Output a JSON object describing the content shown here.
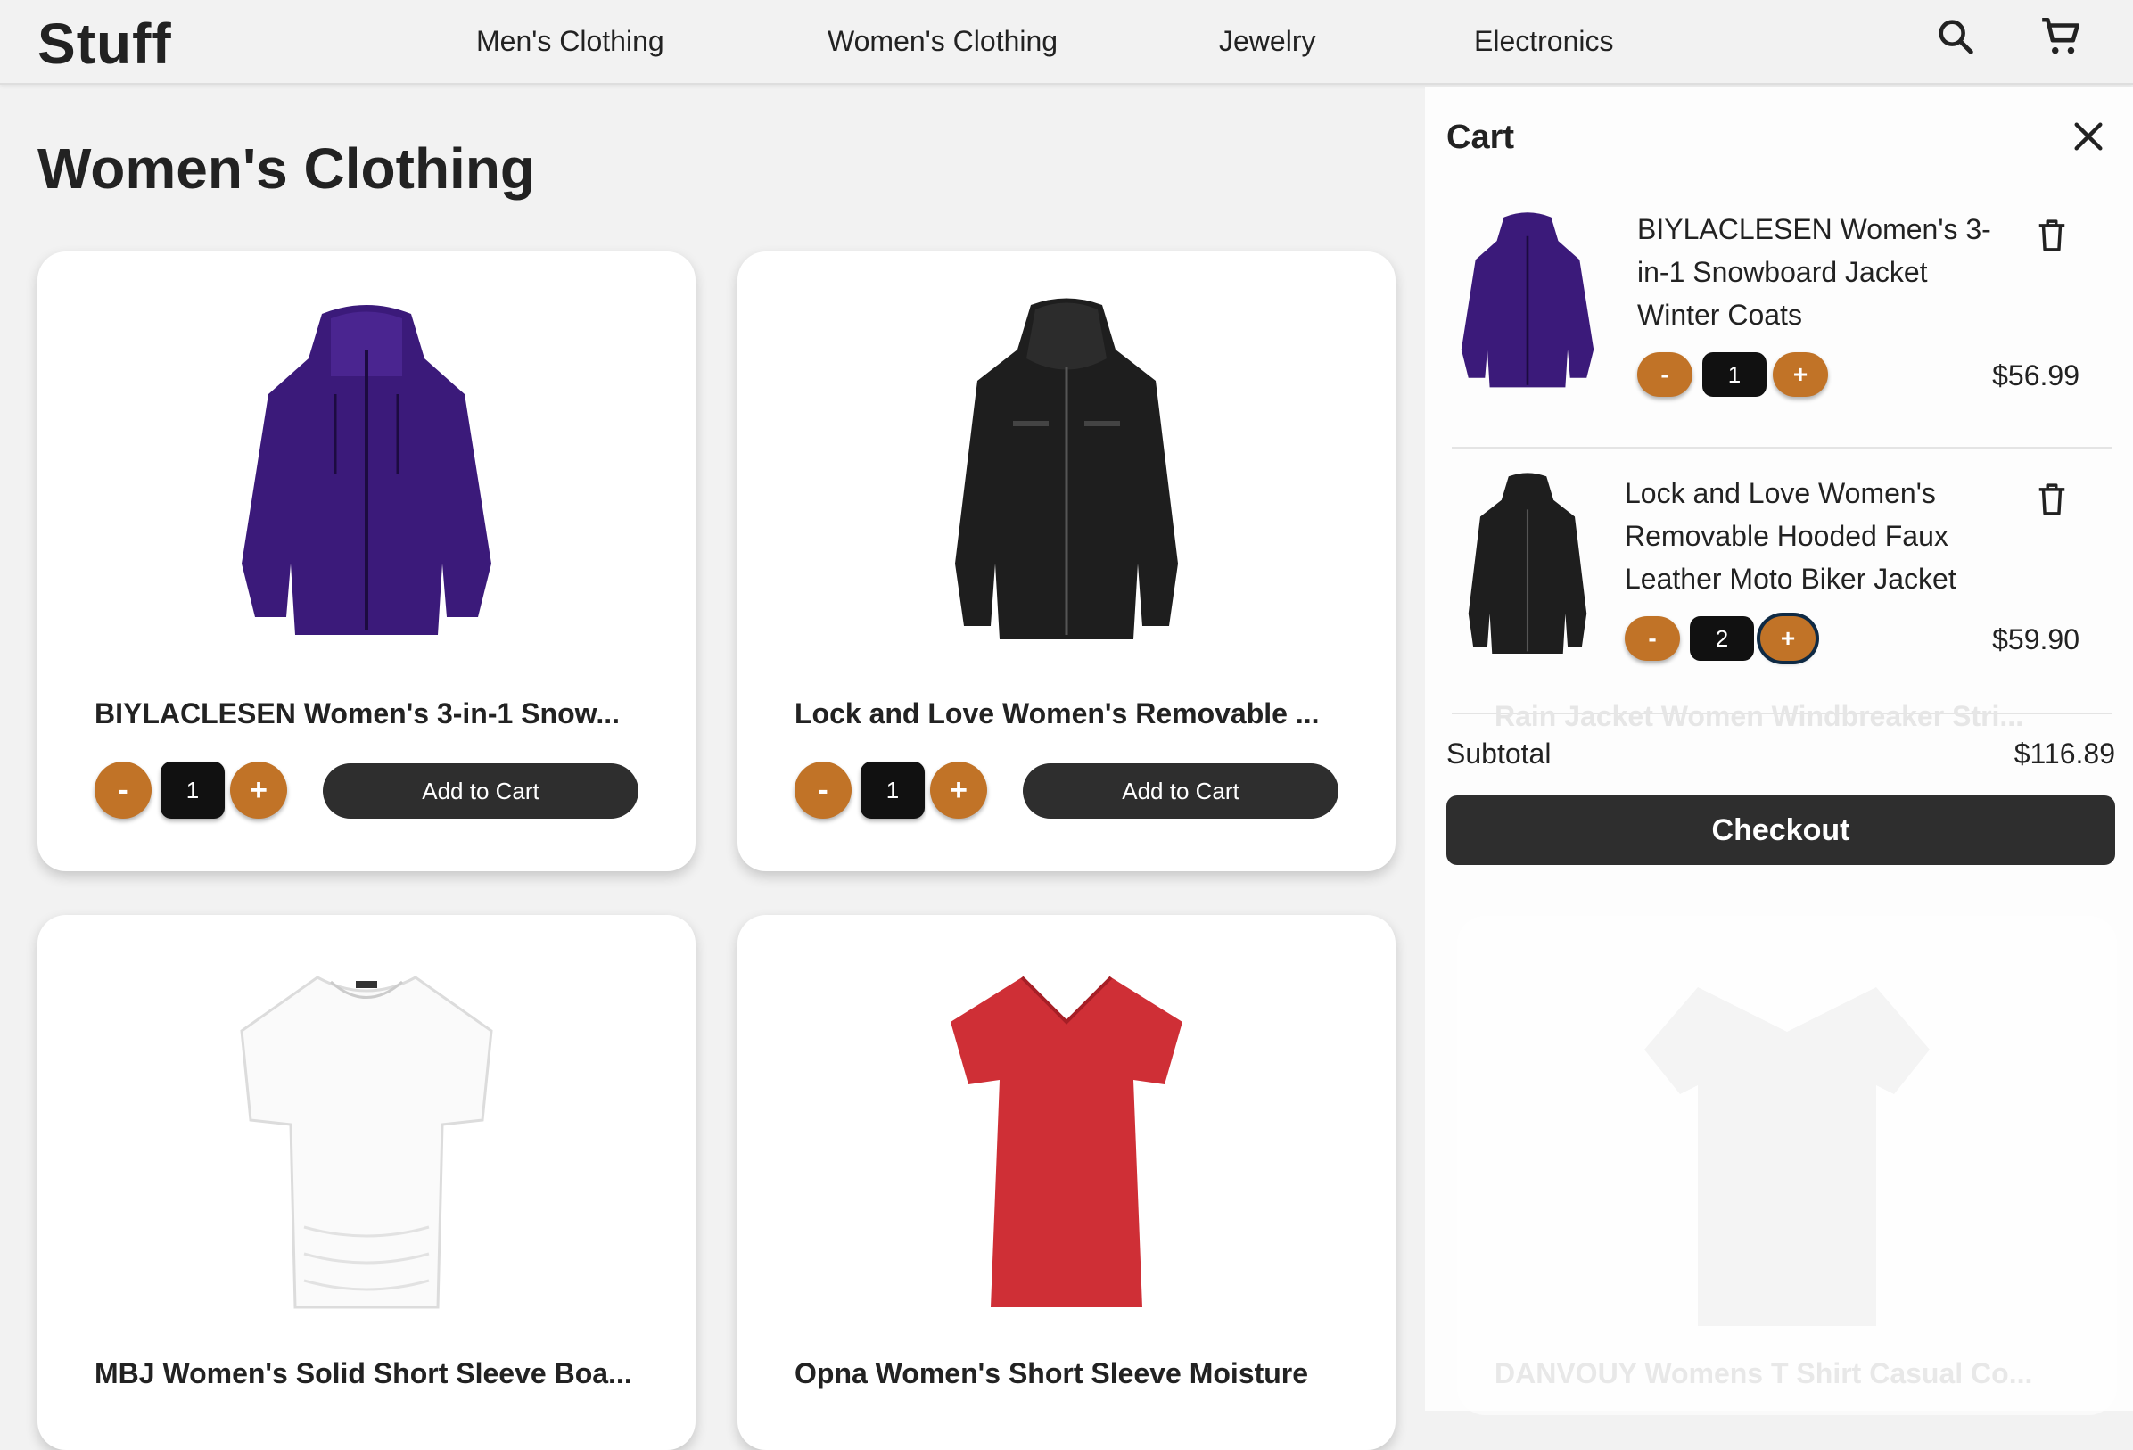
{
  "brand": "Stuff",
  "nav": {
    "links": [
      "Men's Clothing",
      "Women's Clothing",
      "Jewelry",
      "Electronics"
    ],
    "search_icon": "search-icon",
    "cart_icon": "cart-icon"
  },
  "page_title": "Women's Clothing",
  "colors": {
    "accent": "#c17327",
    "dark": "#2e2e2e",
    "background": "#f2f2f2"
  },
  "products": [
    {
      "title": "BIYLACLESEN Women's 3-in-1 Snow...",
      "qty": "1",
      "minus": "-",
      "plus": "+",
      "add_label": "Add to Cart"
    },
    {
      "title": "Lock and Love Women's Removable ...",
      "qty": "1",
      "minus": "-",
      "plus": "+",
      "add_label": "Add to Cart"
    },
    {
      "title": "MBJ Women's Solid Short Sleeve Boa..."
    },
    {
      "title": "Opna Women's Short Sleeve Moisture"
    }
  ],
  "cart": {
    "title": "Cart",
    "close_icon": "close-icon",
    "items": [
      {
        "name": "BIYLACLESEN Women's 3-in-1 Snowboard Jacket Winter Coats",
        "qty": "1",
        "price": "$56.99",
        "minus": "-",
        "plus": "+"
      },
      {
        "name": "Lock and Love Women's Removable Hooded Faux Leather Moto Biker Jacket",
        "qty": "2",
        "price": "$59.90",
        "minus": "-",
        "plus": "+"
      }
    ],
    "subtotal_label": "Subtotal",
    "subtotal_value": "$116.89",
    "checkout_label": "Checkout"
  },
  "background_faded": {
    "item_title": "Rain Jacket Women Windbreaker Stri...",
    "card_title": "DANVOUY Womens T Shirt Casual Co..."
  }
}
